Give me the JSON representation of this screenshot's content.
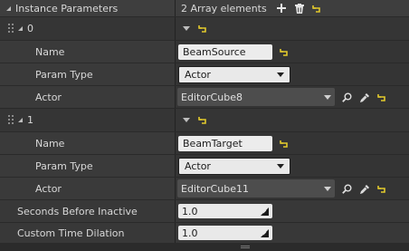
{
  "header": {
    "label": "Instance Parameters",
    "array_count": "2 Array elements"
  },
  "elements": [
    {
      "index": "0",
      "name_label": "Name",
      "name_value": "BeamSource",
      "param_type_label": "Param Type",
      "param_type_value": "Actor",
      "actor_label": "Actor",
      "actor_value": "EditorCube8"
    },
    {
      "index": "1",
      "name_label": "Name",
      "name_value": "BeamTarget",
      "param_type_label": "Param Type",
      "param_type_value": "Actor",
      "actor_label": "Actor",
      "actor_value": "EditorCube11"
    }
  ],
  "seconds_before_inactive": {
    "label": "Seconds Before Inactive",
    "value": "1.0"
  },
  "custom_time_dilation": {
    "label": "Custom Time Dilation",
    "value": "1.0"
  },
  "colors": {
    "reset_arrow": "#e2c92c",
    "panel_bg": "#383838"
  }
}
